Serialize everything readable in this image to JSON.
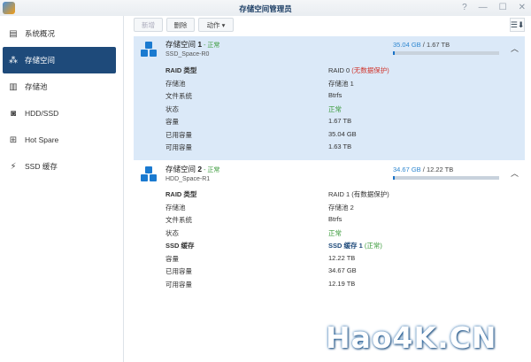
{
  "window": {
    "title": "存储空间管理员",
    "help": "?",
    "minimize": "—",
    "maximize": "☐",
    "close": "✕"
  },
  "sidebar": {
    "items": [
      {
        "label": "系统概况",
        "icon": "overview-icon"
      },
      {
        "label": "存储空间",
        "icon": "volume-icon",
        "active": true
      },
      {
        "label": "存储池",
        "icon": "pool-icon"
      },
      {
        "label": "HDD/SSD",
        "icon": "disk-icon"
      },
      {
        "label": "Hot Spare",
        "icon": "hot-spare-icon"
      },
      {
        "label": "SSD 缓存",
        "icon": "ssd-cache-icon"
      }
    ]
  },
  "toolbar": {
    "new": "新增",
    "delete": "删除",
    "action": "动作 ▾",
    "sort": "☰⬇"
  },
  "volumes": [
    {
      "name": "存储空间",
      "num": "1",
      "status": " - 正常",
      "sub": "SSD_Space-R0",
      "used": "35.04 GB",
      "total": " / 1.67 TB",
      "usage_fraction": 0.02,
      "rows": [
        {
          "k": "RAID 类型",
          "v": "RAID 0 ",
          "extra": "(无数据保护)"
        },
        {
          "k": "存储池",
          "v": "存储池 1"
        },
        {
          "k": "文件系统",
          "v": "Btrfs"
        },
        {
          "k": "状态",
          "v": "正常"
        },
        {
          "k": "容量",
          "v": "1.67 TB"
        },
        {
          "k": "已用容量",
          "v": "35.04 GB"
        },
        {
          "k": "可用容量",
          "v": "1.63 TB"
        }
      ]
    },
    {
      "name": "存储空间",
      "num": "2",
      "status": " - 正常",
      "sub": "HDD_Space-R1",
      "used": "34.67 GB",
      "total": " / 12.22 TB",
      "usage_fraction": 0.003,
      "rows": [
        {
          "k": "RAID 类型",
          "v": "RAID 1 (有数据保护)"
        },
        {
          "k": "存储池",
          "v": "存储池 2"
        },
        {
          "k": "文件系统",
          "v": "Btrfs"
        },
        {
          "k": "状态",
          "v": "正常"
        },
        {
          "k": "SSD 缓存",
          "v": "SSD 缓存 1",
          "extra": " (正常)"
        },
        {
          "k": "容量",
          "v": "12.22 TB"
        },
        {
          "k": "已用容量",
          "v": "34.67 GB"
        },
        {
          "k": "可用容量",
          "v": "12.19 TB"
        }
      ]
    }
  ],
  "watermark": "Hao4K.CN"
}
